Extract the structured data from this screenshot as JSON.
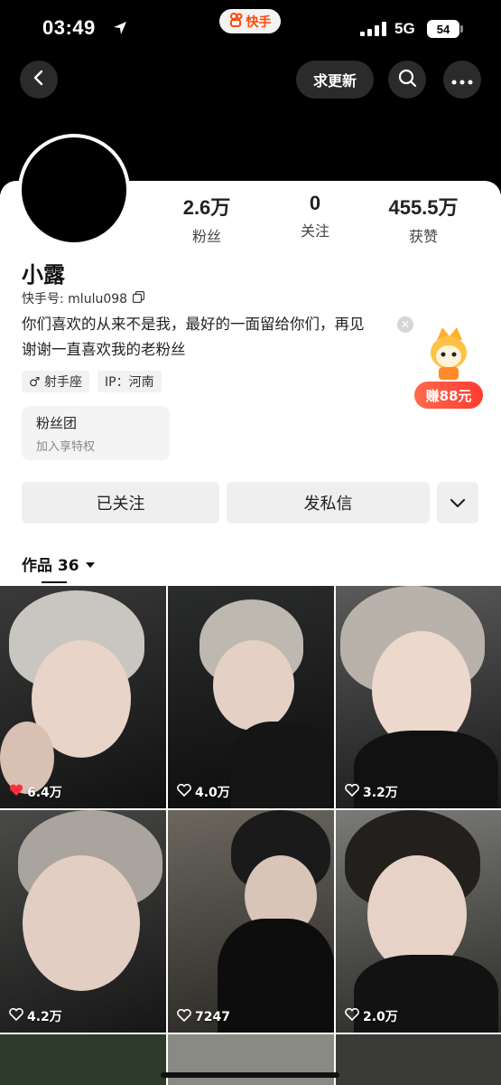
{
  "status_bar": {
    "time": "03:49",
    "app_label": "快手",
    "network": "5G",
    "battery": "54"
  },
  "nav": {
    "request_update_label": "求更新",
    "back_icon": "chevron-left-icon",
    "search_icon": "search-icon",
    "more_icon": "more-dots-icon"
  },
  "stats": [
    {
      "value": "2.6万",
      "label": "粉丝"
    },
    {
      "value": "0",
      "label": "关注"
    },
    {
      "value": "455.5万",
      "label": "获赞"
    }
  ],
  "profile": {
    "name": "小露",
    "user_id": "快手号: mlulu098",
    "bio_line1": "你们喜欢的从来不是我，最好的一面留给你们，再见",
    "bio_line2": "谢谢一直喜欢我的老粉丝",
    "tags": [
      {
        "icon": "male-icon",
        "label": "♂ 射手座"
      },
      {
        "label": "IP：河南"
      }
    ]
  },
  "promo": {
    "badge": "赚88元"
  },
  "fanclub": {
    "title": "粉丝团",
    "subtitle": "加入享特权"
  },
  "actions": {
    "followed_label": "已关注",
    "message_label": "发私信"
  },
  "works": {
    "label": "作品 36"
  },
  "grid": [
    {
      "likes": "6.4万",
      "liked": true
    },
    {
      "likes": "4.0万",
      "liked": false
    },
    {
      "likes": "3.2万",
      "liked": false
    },
    {
      "likes": "4.2万",
      "liked": false
    },
    {
      "likes": "7247",
      "liked": false
    },
    {
      "likes": "2.0万",
      "liked": false
    }
  ],
  "colors": {
    "brand": "#ff4906",
    "like_red": "#ff2d3d",
    "promo_red": "#ff3b30"
  }
}
